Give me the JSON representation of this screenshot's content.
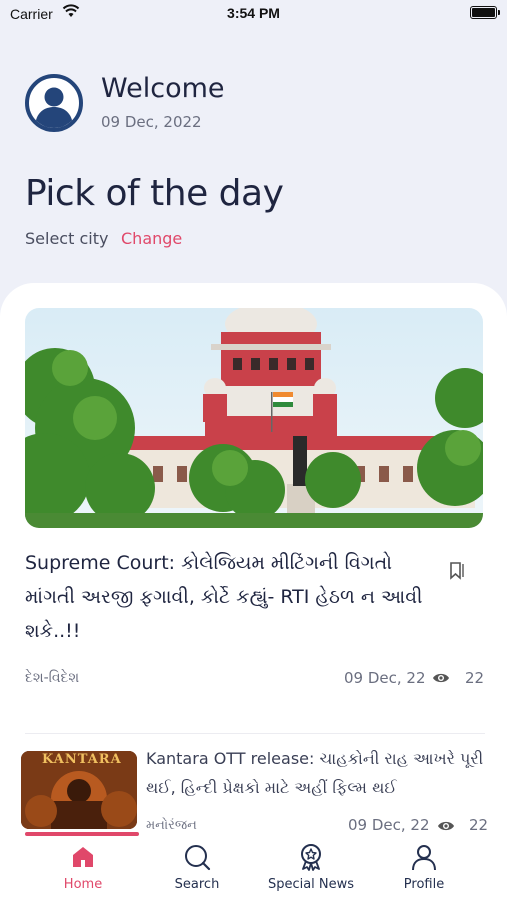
{
  "status_bar": {
    "carrier": "Carrier",
    "time": "3:54 PM"
  },
  "header": {
    "welcome": "Welcome",
    "date": "09 Dec, 2022"
  },
  "pick": {
    "title": "Pick of the day",
    "select_city": "Select city",
    "change": "Change"
  },
  "featured": {
    "headline": "Supreme Court: કોલેજિયમ મીટિંગની વિગતો માંગતી અરજી ફગાવી, કોર્ટે કહ્યું- RTI હેઠળ ન આવી શકે..!!",
    "category": "દેશ-વિદેશ",
    "date": "09 Dec, 22",
    "views": "22"
  },
  "second_item": {
    "thumb_text": "KANTARA",
    "headline": "Kantara OTT release: ચાહકોની રાહ આખરે પૂરી થઈ, હિન્દી પ્રેક્ષકો માટે અહીં ફિલ્મ થઈ",
    "category": "મનોરંજન",
    "date": "09 Dec, 22",
    "views": "22"
  },
  "tabs": [
    {
      "label": "Home",
      "icon": "home-icon",
      "active": true
    },
    {
      "label": "Search",
      "icon": "search-icon",
      "active": false
    },
    {
      "label": "Special News",
      "icon": "award-icon",
      "active": false
    },
    {
      "label": "Profile",
      "icon": "user-icon",
      "active": false
    }
  ],
  "colors": {
    "accent": "#e0486a",
    "navy": "#24457a",
    "background": "#eef0f8"
  }
}
